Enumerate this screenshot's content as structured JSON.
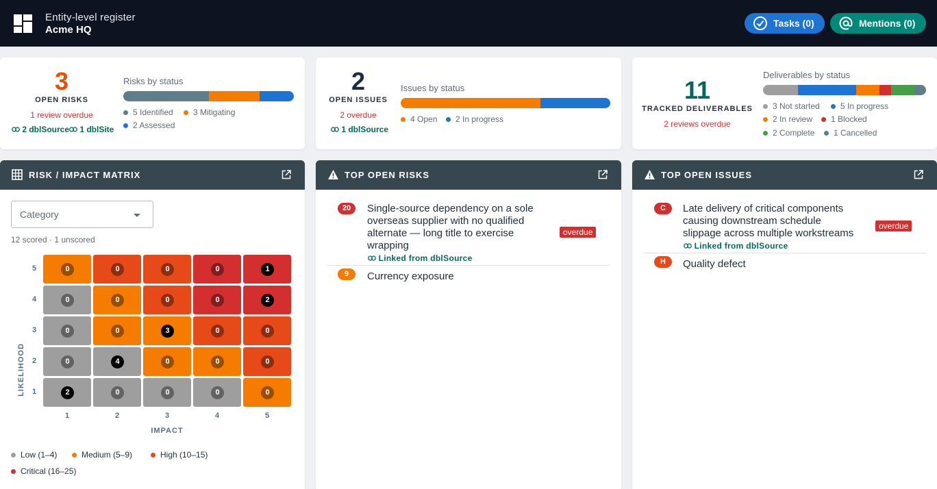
{
  "header": {
    "subtitle": "Entity-level register",
    "title": "Acme HQ",
    "tasks_label": "Tasks (0)",
    "mentions_label": "Mentions (0)"
  },
  "risks_card": {
    "count": "3",
    "label": "OPEN RISKS",
    "warning": "1 review overdue",
    "link1": "2 dblSource",
    "link2": "1 dblSite",
    "status_title": "Risks by status",
    "bar": [
      {
        "value": 5,
        "color": "#607d8b"
      },
      {
        "value": 3,
        "color": "#f57c00"
      },
      {
        "value": 2,
        "color": "#1e74d2"
      }
    ],
    "legend": [
      {
        "text": "5 Identified",
        "color": "#607d8b"
      },
      {
        "text": "3 Mitigating",
        "color": "#f57c00"
      },
      {
        "text": "2 Assessed",
        "color": "#1e74d2"
      }
    ]
  },
  "issues_card": {
    "count": "2",
    "label": "OPEN ISSUES",
    "warning": "2 overdue",
    "link1": "1 dblSource",
    "status_title": "Issues by status",
    "bar": [
      {
        "value": 4,
        "color": "#f57c00"
      },
      {
        "value": 2,
        "color": "#1e74d2"
      }
    ],
    "legend": [
      {
        "text": "4 Open",
        "color": "#f57c00"
      },
      {
        "text": "2 In progress",
        "color": "#1e74d2"
      }
    ]
  },
  "deliverables_card": {
    "count": "11",
    "label": "TRACKED DELIVERABLES",
    "warning": "2 reviews overdue",
    "status_title": "Deliverables by status",
    "bar": [
      {
        "value": 3,
        "color": "#9e9e9e"
      },
      {
        "value": 5,
        "color": "#1e74d2"
      },
      {
        "value": 2,
        "color": "#f57c00"
      },
      {
        "value": 1,
        "color": "#d32f2f"
      },
      {
        "value": 2,
        "color": "#43a047"
      },
      {
        "value": 1,
        "color": "#607d8b"
      }
    ],
    "legend": [
      {
        "text": "3 Not started",
        "color": "#9e9e9e"
      },
      {
        "text": "5 In progress",
        "color": "#1e74d2"
      },
      {
        "text": "2 In review",
        "color": "#f57c00"
      },
      {
        "text": "1 Blocked",
        "color": "#d32f2f"
      },
      {
        "text": "2 Complete",
        "color": "#43a047"
      },
      {
        "text": "1 Cancelled",
        "color": "#607d8b"
      }
    ]
  },
  "matrix": {
    "title": "RISK / IMPACT MATRIX",
    "select_placeholder": "Category",
    "scored_text": "12 scored · 1 unscored",
    "y_axis": "LIKELIHOOD",
    "x_axis": "IMPACT",
    "y_ticks": [
      "5",
      "4",
      "3",
      "2",
      "1"
    ],
    "x_ticks": [
      "1",
      "2",
      "3",
      "4",
      "5"
    ],
    "colors": {
      "low": "#9e9e9e",
      "medium": "#f57c00",
      "high": "#e64a19",
      "critical": "#d32f2f"
    },
    "rows": [
      {
        "levels": [
          "medium",
          "high",
          "high",
          "critical",
          "critical"
        ],
        "counts": [
          "0",
          "0",
          "0",
          "0",
          "1"
        ]
      },
      {
        "levels": [
          "low",
          "medium",
          "high",
          "critical",
          "critical"
        ],
        "counts": [
          "0",
          "0",
          "0",
          "0",
          "2"
        ]
      },
      {
        "levels": [
          "low",
          "medium",
          "medium",
          "high",
          "high"
        ],
        "counts": [
          "0",
          "0",
          "3",
          "0",
          "0"
        ]
      },
      {
        "levels": [
          "low",
          "low",
          "medium",
          "medium",
          "high"
        ],
        "counts": [
          "0",
          "4",
          "0",
          "0",
          "0"
        ]
      },
      {
        "levels": [
          "low",
          "low",
          "low",
          "low",
          "medium"
        ],
        "counts": [
          "2",
          "0",
          "0",
          "0",
          "0"
        ]
      }
    ],
    "legend": [
      {
        "text": "Low (1–4)",
        "color": "#9e9e9e"
      },
      {
        "text": "Medium (5–9)",
        "color": "#f57c00"
      },
      {
        "text": "High (10–15)",
        "color": "#e64a19"
      },
      {
        "text": "Critical (16–25)",
        "color": "#d32f2f"
      }
    ]
  },
  "top_risks": {
    "title": "TOP OPEN RISKS",
    "items": [
      {
        "score": "20",
        "score_color": "#d32f2f",
        "lines": [
          "Single-source dependency on a sole",
          "overseas supplier with no qualified",
          "alternate — long title to exercise",
          "wrapping"
        ],
        "overdue": "overdue",
        "linked": "Linked from dblSource"
      },
      {
        "score": "9",
        "score_color": "#f57c00",
        "lines": [
          "Currency exposure"
        ]
      }
    ]
  },
  "top_issues": {
    "title": "TOP OPEN ISSUES",
    "items": [
      {
        "score": "C",
        "score_color": "#d32f2f",
        "lines": [
          "Late delivery of critical components",
          "causing downstream schedule",
          "slippage across multiple workstreams"
        ],
        "overdue": "overdue",
        "linked": "Linked from dblSource"
      },
      {
        "score": "H",
        "score_color": "#e64a19",
        "lines": [
          "Quality defect"
        ]
      }
    ]
  }
}
